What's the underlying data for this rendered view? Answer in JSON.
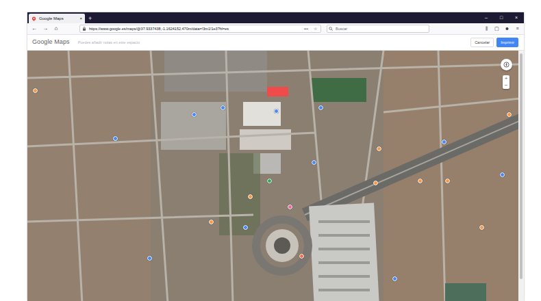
{
  "window": {
    "controls": [
      "–",
      "□",
      "×"
    ]
  },
  "tabs": [
    {
      "label": "Google Maps",
      "selected": true,
      "close": "×"
    }
  ],
  "new_tab": "+",
  "toolbar": {
    "nav": [
      "←",
      "→",
      "⌂"
    ],
    "url": "https://www.google.es/maps/@37.9337438,-1.1624152,470m/data=!3m1!1e3?hl=es",
    "url_actions": [
      "•••",
      "☆"
    ],
    "search": {
      "placeholder": "Buscar"
    },
    "icons": [
      "⫼",
      "▢",
      "☻",
      "≡"
    ]
  },
  "maps_header": {
    "logo": "Google Maps",
    "notes": {
      "placeholder": "Puedes añadir notas en este espacio"
    },
    "buttons": [
      {
        "label": "Cancelar",
        "primary": false
      },
      {
        "label": "Imprimir",
        "primary": true
      }
    ]
  },
  "map": {
    "marker": {
      "color": "#f04b4b"
    },
    "zoom": [
      "+",
      "−"
    ],
    "pins": [
      {
        "color": "#4a89f3"
      },
      {
        "color": "#4a89f3"
      },
      {
        "color": "#4a89f3"
      },
      {
        "color": "#4a89f3"
      },
      {
        "color": "#4a89f3"
      },
      {
        "color": "#34a853"
      },
      {
        "color": "#f29a4a"
      },
      {
        "color": "#f29a4a"
      },
      {
        "color": "#4a89f3"
      },
      {
        "color": "#e86a9c"
      },
      {
        "color": "#f0704a"
      },
      {
        "color": "#f29a4a"
      },
      {
        "color": "#f29a4a"
      },
      {
        "color": "#f29a4a"
      },
      {
        "color": "#f29a4a"
      },
      {
        "color": "#4a89f3"
      },
      {
        "color": "#4a89f3"
      },
      {
        "color": "#f29a4a"
      },
      {
        "color": "#4a89f3"
      },
      {
        "color": "#f29a4a"
      },
      {
        "color": "#4a89f3"
      },
      {
        "color": "#f29a4a"
      },
      {
        "color": "#4a89f3"
      }
    ]
  }
}
